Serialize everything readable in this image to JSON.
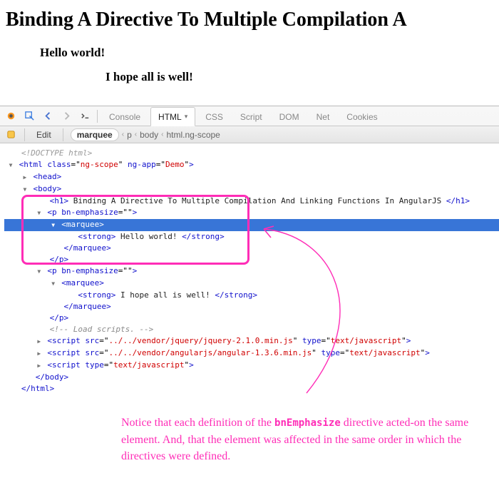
{
  "page": {
    "title": "Binding A Directive To Multiple Compilation A",
    "demo_line1": "Hello world!",
    "demo_line2": "I hope all is well!"
  },
  "firebug": {
    "tabs": {
      "console": "Console",
      "html": "HTML",
      "css": "CSS",
      "script": "Script",
      "dom": "DOM",
      "net": "Net",
      "cookies": "Cookies"
    },
    "subbar": {
      "edit": "Edit",
      "crumbs": {
        "c0": "marquee",
        "c1": "p",
        "c2": "body",
        "c3": "html.ng-scope"
      }
    }
  },
  "source": {
    "doctype": "<!DOCTYPE html>",
    "html_open": {
      "tag": "html",
      "attr_class": "class",
      "class_val": "ng-scope",
      "attr_app": "ng-app",
      "app_val": "Demo"
    },
    "head": "head",
    "body": "body",
    "h1_text": " Binding A Directive To Multiple Compilation And Linking Functions In AngularJS ",
    "h1_tag": "h1",
    "p": "p",
    "bn_attr": "bn-emphasize",
    "marquee": "marquee",
    "strong": "strong",
    "hello": " Hello world! ",
    "hope": " I hope all is well! ",
    "comment": "<!-- Load scripts. -->",
    "script_tag": "script",
    "src_attr": "src",
    "type_attr": "type",
    "type_val": "text/javascript",
    "jquery_src": "../../vendor/jquery/jquery-2.1.0.min.js",
    "angular_src": "../../vendor/angularjs/angular-1.3.6.min.js",
    "html_close": "/html"
  },
  "annotation": {
    "text_1": "Notice that each definition of the ",
    "bn_name": "bnEmphasize",
    "text_2": " directive acted-on the same element. And, that the element was affected in the same order in which the directives were defined."
  }
}
